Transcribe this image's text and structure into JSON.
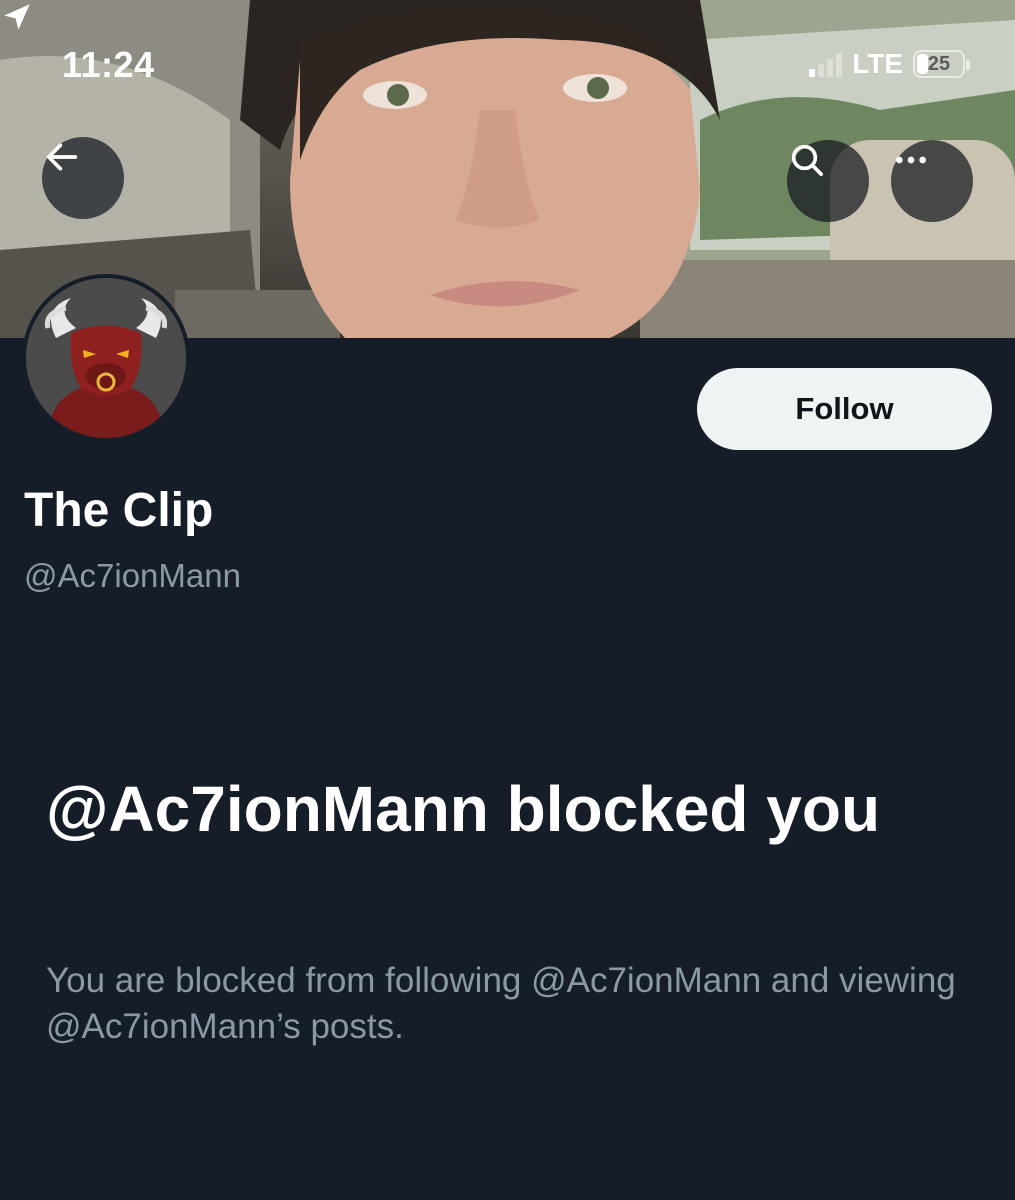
{
  "status_bar": {
    "time": "11:24",
    "network": "LTE",
    "battery": "25",
    "battery_level": 0.25,
    "location_icon": "location-arrow-icon"
  },
  "header": {
    "back_icon": "arrow-left-icon",
    "search_icon": "search-icon",
    "more_icon": "more-horizontal-icon"
  },
  "profile": {
    "display_name": "The Clip",
    "handle": "@Ac7ionMann",
    "follow_label": "Follow",
    "avatar_icon": "bull-avatar-icon"
  },
  "blocked": {
    "title": "@Ac7ionMann blocked you",
    "description": "You are blocked from following @Ac7ionMann and viewing @Ac7ionMann’s posts."
  },
  "colors": {
    "background": "#151d28",
    "primary_text": "#ffffff",
    "secondary_text": "#8b98a5",
    "follow_button_bg": "#eff3f4",
    "follow_button_text": "#0f1419"
  }
}
